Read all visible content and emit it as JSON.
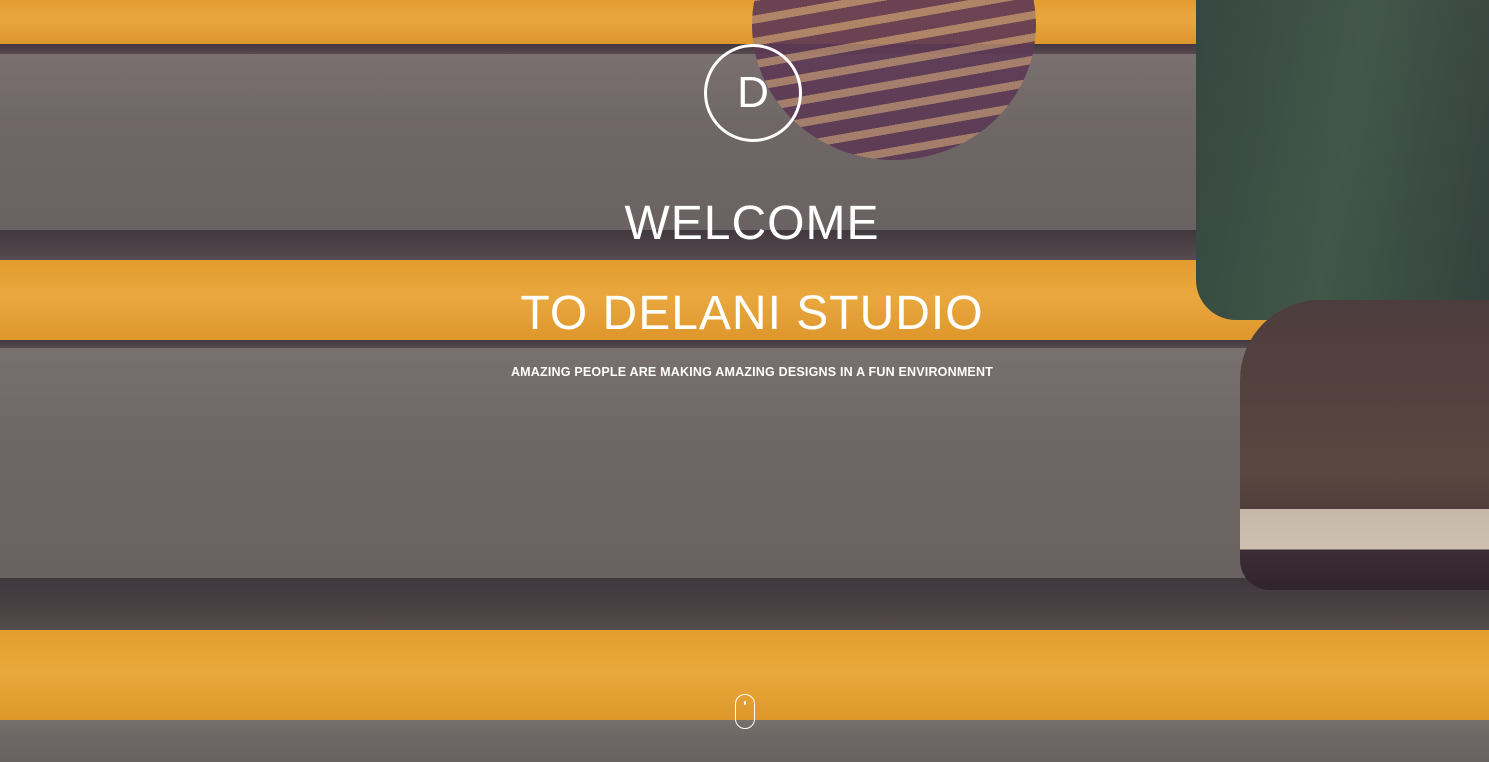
{
  "hero": {
    "logo_letter": "D",
    "title_line_1": "WELCOME",
    "title_line_2": "TO DELANI STUDIO",
    "tagline": "AMAZING PEOPLE ARE MAKING AMAZING DESIGNS IN A FUN ENVIRONMENT",
    "scroll_icon": "mouse-scroll-icon"
  },
  "colors": {
    "text": "#ffffff",
    "stripe_yellow": "#f6b53a",
    "concrete_gray": "#6f6e66"
  }
}
